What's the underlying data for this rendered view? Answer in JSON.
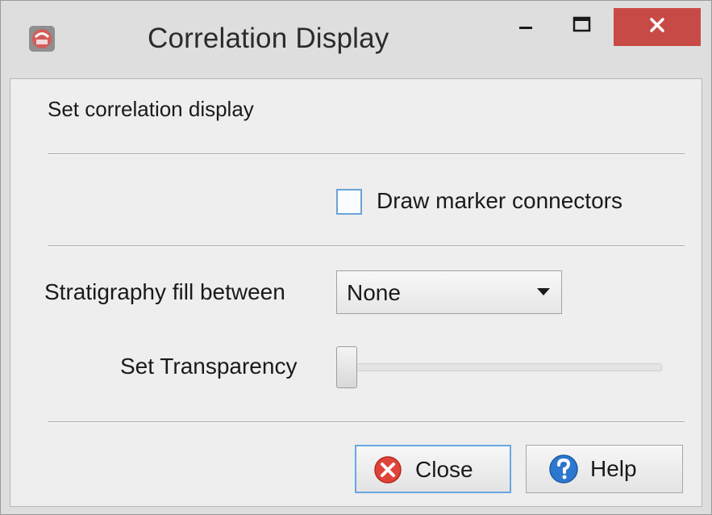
{
  "window": {
    "title": "Correlation Display",
    "app_icon": "app-icon"
  },
  "titlebar_buttons": {
    "minimize_icon": "minimize-icon",
    "maximize_icon": "maximize-icon",
    "close_icon": "close-icon",
    "close_color": "#c84a47"
  },
  "section": {
    "label": "Set correlation display"
  },
  "marker_connectors": {
    "label": "Draw marker connectors",
    "checked": false
  },
  "stratigraphy_fill": {
    "label": "Stratigraphy fill between",
    "selected": "None"
  },
  "transparency": {
    "label": "Set Transparency",
    "value": 0
  },
  "buttons": {
    "close": {
      "label": "Close",
      "icon": "close-circle-icon",
      "color": "#e0433a"
    },
    "help": {
      "label": "Help",
      "icon": "help-circle-icon",
      "color": "#2d77cf"
    }
  }
}
